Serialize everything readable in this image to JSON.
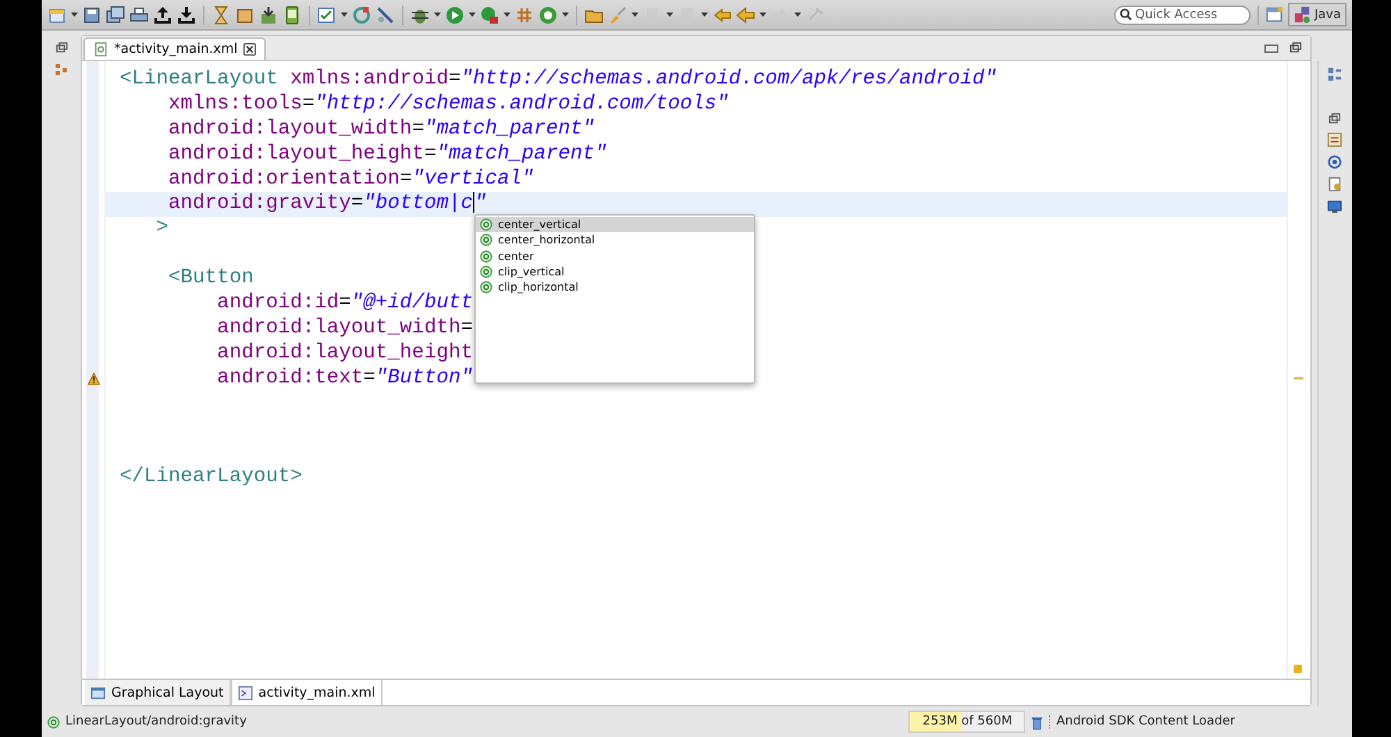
{
  "toolbar": {
    "quick_access": {
      "placeholder": "Quick Access"
    },
    "perspective": {
      "label": "Java",
      "selected": true
    }
  },
  "editor_tabs": [
    {
      "label": "*activity_main.xml",
      "selected": true
    }
  ],
  "code_lines": [
    {
      "current": false,
      "tokens": [
        {
          "kind": "tag",
          "text": "<LinearLayout"
        },
        {
          "kind": "attr",
          "text": " xmlns:android"
        },
        {
          "kind": "plain",
          "text": "="
        },
        {
          "kind": "value",
          "text": "\"http://schemas.android.com/apk/res/android\""
        }
      ]
    },
    {
      "current": false,
      "tokens": [
        {
          "kind": "attr",
          "text": "    xmlns:tools"
        },
        {
          "kind": "plain",
          "text": "="
        },
        {
          "kind": "value",
          "text": "\"http://schemas.android.com/tools\""
        }
      ]
    },
    {
      "current": false,
      "tokens": [
        {
          "kind": "attr",
          "text": "    android:layout_width"
        },
        {
          "kind": "plain",
          "text": "="
        },
        {
          "kind": "value",
          "text": "\"match_parent\""
        }
      ]
    },
    {
      "current": false,
      "tokens": [
        {
          "kind": "attr",
          "text": "    android:layout_height"
        },
        {
          "kind": "plain",
          "text": "="
        },
        {
          "kind": "value",
          "text": "\"match_parent\""
        }
      ]
    },
    {
      "current": false,
      "tokens": [
        {
          "kind": "attr",
          "text": "    android:orientation"
        },
        {
          "kind": "plain",
          "text": "="
        },
        {
          "kind": "value",
          "text": "\"vertical\""
        }
      ]
    },
    {
      "current": true,
      "tokens": [
        {
          "kind": "attr",
          "text": "    android:gravity"
        },
        {
          "kind": "plain",
          "text": "="
        },
        {
          "kind": "value",
          "text": "\"bottom|c"
        },
        {
          "kind": "caret"
        },
        {
          "kind": "value",
          "text": "\""
        }
      ]
    },
    {
      "current": false,
      "tokens": [
        {
          "kind": "tag",
          "text": "   >"
        }
      ]
    },
    {
      "current": false
    },
    {
      "current": false,
      "tokens": [
        {
          "kind": "tag",
          "text": "    <Button"
        }
      ]
    },
    {
      "current": false,
      "tokens": [
        {
          "kind": "attr",
          "text": "        android:id"
        },
        {
          "kind": "plain",
          "text": "="
        },
        {
          "kind": "value",
          "text": "\"@+id/butt"
        }
      ]
    },
    {
      "current": false,
      "tokens": [
        {
          "kind": "attr",
          "text": "        android:layout_width"
        },
        {
          "kind": "plain",
          "text": "="
        }
      ]
    },
    {
      "current": false,
      "tokens": [
        {
          "kind": "attr",
          "text": "        android:layout_height"
        }
      ]
    },
    {
      "current": false,
      "warning": true,
      "tokens": [
        {
          "kind": "attr",
          "text": "        android:text"
        },
        {
          "kind": "plain",
          "text": "="
        },
        {
          "kind": "value",
          "text": "\"Button\""
        }
      ]
    },
    {
      "current": false
    },
    {
      "current": false
    },
    {
      "current": false
    },
    {
      "current": false,
      "tokens": [
        {
          "kind": "tag",
          "text": "</LinearLayout>"
        }
      ]
    }
  ],
  "completion_popup": {
    "items": [
      {
        "label": "center_vertical",
        "selected": true
      },
      {
        "label": "center_horizontal",
        "selected": false
      },
      {
        "label": "center",
        "selected": false
      },
      {
        "label": "clip_vertical",
        "selected": false
      },
      {
        "label": "clip_horizontal",
        "selected": false
      }
    ]
  },
  "bottom_tabs": [
    {
      "label": "Graphical Layout",
      "selected": false
    },
    {
      "label": "activity_main.xml",
      "selected": true
    }
  ],
  "status_bar": {
    "path": "LinearLayout/android:gravity",
    "memory": {
      "text": "253M of 560M",
      "level": 0.45
    },
    "job": "Android SDK Content Loader"
  }
}
